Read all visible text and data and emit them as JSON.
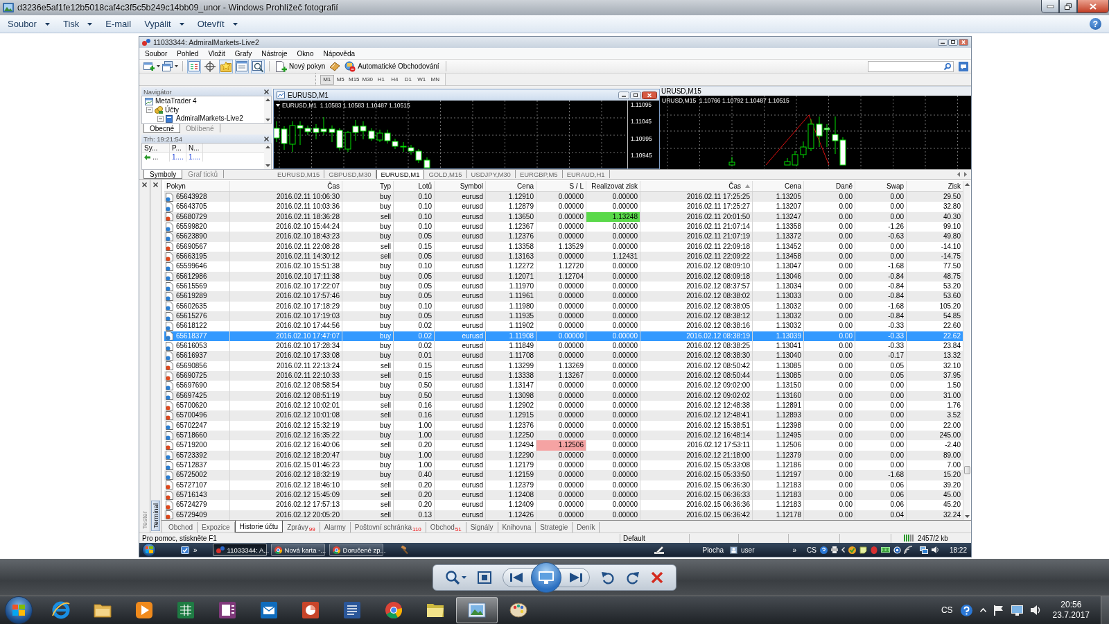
{
  "window": {
    "title": "d3236e5af1fe12b5018caf4c3f5c5b249c14bb09_unor - Windows Prohlížeč fotografií"
  },
  "menu": [
    {
      "label": "Soubor",
      "dropdown": true
    },
    {
      "label": "Tisk",
      "dropdown": true
    },
    {
      "label": "E-mail",
      "dropdown": false
    },
    {
      "label": "Vypálit",
      "dropdown": true
    },
    {
      "label": "Otevřít",
      "dropdown": true
    }
  ],
  "help": "?",
  "mt4": {
    "title": "11033344: AdmiralMarkets-Live2",
    "menu": [
      "Soubor",
      "Pohled",
      "Vložit",
      "Grafy",
      "Nástroje",
      "Okno",
      "Nápověda"
    ],
    "toolbar": {
      "toggles": [
        {
          "kind": "market-watch",
          "on": true
        },
        {
          "kind": "crosshair",
          "on": false
        },
        {
          "kind": "navigator",
          "on": true
        },
        {
          "kind": "terminal",
          "on": true
        },
        {
          "kind": "tester",
          "on": true
        }
      ],
      "new_order": "Nový pokyn",
      "auto_trading": "Automatické Obchodování"
    },
    "timeframes": [
      {
        "label": "M1",
        "selected": true
      },
      {
        "label": "M5",
        "selected": false
      },
      {
        "label": "M15",
        "selected": false
      },
      {
        "label": "M30",
        "selected": false
      },
      {
        "label": "H1",
        "selected": false
      },
      {
        "label": "H4",
        "selected": false
      },
      {
        "label": "D1",
        "selected": false
      },
      {
        "label": "W1",
        "selected": false
      },
      {
        "label": "MN",
        "selected": false
      }
    ],
    "navigator": {
      "title": "Navigátor",
      "tree": [
        {
          "label": "MetaTrader 4",
          "children": [
            {
              "label": "Účty",
              "expanded": true,
              "children": [
                {
                  "label": "AdmiralMarkets-Live2",
                  "expanded": true
                }
              ]
            }
          ]
        }
      ],
      "tabs": [
        {
          "label": "Obecné",
          "selected": true
        },
        {
          "label": "Oblíbené",
          "selected": false
        }
      ]
    },
    "market_watch": {
      "title": "Trh: 19:21:54",
      "columns": [
        "Sy...",
        "P...",
        "N..."
      ],
      "rows": [
        [
          "...",
          "1....",
          "1...."
        ]
      ],
      "tabs": [
        {
          "label": "Symboly",
          "selected": true
        },
        {
          "label": "Graf ticků",
          "selected": false
        }
      ]
    },
    "charts": [
      {
        "title": "EURUSD,M1",
        "active": true,
        "header": "EURUSD,M1  1.10583 1.10583 1.10487 1.10515",
        "price_labels": [
          "1.11095",
          "1.11045",
          "1.10995",
          "1.10945"
        ]
      },
      {
        "title": "URUSD,M15",
        "active": false,
        "header": "URUSD,M15  1.10766 1.10792 1.10487 1.10515"
      }
    ],
    "chart_tabs": [
      {
        "label": "EURUSD,M15",
        "selected": false
      },
      {
        "label": "GBPUSD,M30",
        "selected": false
      },
      {
        "label": "EURUSD,M1",
        "selected": true
      },
      {
        "label": "GOLD,M15",
        "selected": false
      },
      {
        "label": "USDJPY,M30",
        "selected": false
      },
      {
        "label": "EURGBP,M5",
        "selected": false
      },
      {
        "label": "EURAUD,H1",
        "selected": false
      }
    ],
    "terminal": {
      "side_tabs": [
        {
          "label": "Tester",
          "selected": false
        },
        {
          "label": "Terminal",
          "selected": true
        }
      ],
      "columns": [
        {
          "label": "Pokyn",
          "sorted": false
        },
        {
          "label": "Čas",
          "sorted": false
        },
        {
          "label": "Typ",
          "sorted": false
        },
        {
          "label": "Lotů",
          "sorted": false
        },
        {
          "label": "Symbol",
          "sorted": false
        },
        {
          "label": "Cena",
          "sorted": false
        },
        {
          "label": "S / L",
          "sorted": false
        },
        {
          "label": "Realizovat zisk",
          "sorted": false
        },
        {
          "label": "Čas",
          "sorted": true
        },
        {
          "label": "Cena",
          "sorted": false
        },
        {
          "label": "Daně",
          "sorted": false
        },
        {
          "label": "Swap",
          "sorted": false
        },
        {
          "label": "Zisk",
          "sorted": false
        }
      ],
      "rows": [
        {
          "kind": "buy",
          "selected": false,
          "sl_hit": false,
          "tp_hit": false,
          "cells": [
            "65643928",
            "2016.02.11 10:06:30",
            "buy",
            "0.10",
            "eurusd",
            "1.12910",
            "0.00000",
            "0.00000",
            "2016.02.11 17:25:25",
            "1.13205",
            "0.00",
            "0.00",
            "29.50"
          ]
        },
        {
          "kind": "buy",
          "selected": false,
          "sl_hit": false,
          "tp_hit": false,
          "cells": [
            "65643705",
            "2016.02.11 10:03:36",
            "buy",
            "0.10",
            "eurusd",
            "1.12879",
            "0.00000",
            "0.00000",
            "2016.02.11 17:25:27",
            "1.13207",
            "0.00",
            "0.00",
            "32.80"
          ]
        },
        {
          "kind": "sell",
          "selected": false,
          "sl_hit": false,
          "tp_hit": true,
          "cells": [
            "65680729",
            "2016.02.11 18:36:28",
            "sell",
            "0.10",
            "eurusd",
            "1.13650",
            "0.00000",
            "1.13248",
            "2016.02.11 20:01:50",
            "1.13247",
            "0.00",
            "0.00",
            "40.30"
          ]
        },
        {
          "kind": "buy",
          "selected": false,
          "sl_hit": false,
          "tp_hit": false,
          "cells": [
            "65599820",
            "2016.02.10 15:44:24",
            "buy",
            "0.10",
            "eurusd",
            "1.12367",
            "0.00000",
            "0.00000",
            "2016.02.11 21:07:14",
            "1.13358",
            "0.00",
            "-1.26",
            "99.10"
          ]
        },
        {
          "kind": "buy",
          "selected": false,
          "sl_hit": false,
          "tp_hit": false,
          "cells": [
            "65623890",
            "2016.02.10 18:43:23",
            "buy",
            "0.05",
            "eurusd",
            "1.12376",
            "0.00000",
            "0.00000",
            "2016.02.11 21:07:19",
            "1.13372",
            "0.00",
            "-0.63",
            "49.80"
          ]
        },
        {
          "kind": "sell",
          "selected": false,
          "sl_hit": false,
          "tp_hit": false,
          "cells": [
            "65690567",
            "2016.02.11 22:08:28",
            "sell",
            "0.15",
            "eurusd",
            "1.13358",
            "1.13529",
            "0.00000",
            "2016.02.11 22:09:18",
            "1.13452",
            "0.00",
            "0.00",
            "-14.10"
          ]
        },
        {
          "kind": "sell",
          "selected": false,
          "sl_hit": false,
          "tp_hit": false,
          "cells": [
            "65663195",
            "2016.02.11 14:30:12",
            "sell",
            "0.05",
            "eurusd",
            "1.13163",
            "0.00000",
            "1.12431",
            "2016.02.11 22:09:22",
            "1.13458",
            "0.00",
            "0.00",
            "-14.75"
          ]
        },
        {
          "kind": "buy",
          "selected": false,
          "sl_hit": false,
          "tp_hit": false,
          "cells": [
            "65599646",
            "2016.02.10 15:51:38",
            "buy",
            "0.10",
            "eurusd",
            "1.12272",
            "1.12720",
            "0.00000",
            "2016.02.12 08:09:10",
            "1.13047",
            "0.00",
            "-1.68",
            "77.50"
          ]
        },
        {
          "kind": "buy",
          "selected": false,
          "sl_hit": false,
          "tp_hit": false,
          "cells": [
            "65612986",
            "2016.02.10 17:11:38",
            "buy",
            "0.05",
            "eurusd",
            "1.12071",
            "1.12704",
            "0.00000",
            "2016.02.12 08:09:18",
            "1.13046",
            "0.00",
            "-0.84",
            "48.75"
          ]
        },
        {
          "kind": "buy",
          "selected": false,
          "sl_hit": false,
          "tp_hit": false,
          "cells": [
            "65615569",
            "2016.02.10 17:22:07",
            "buy",
            "0.05",
            "eurusd",
            "1.11970",
            "0.00000",
            "0.00000",
            "2016.02.12 08:37:57",
            "1.13034",
            "0.00",
            "-0.84",
            "53.20"
          ]
        },
        {
          "kind": "buy",
          "selected": false,
          "sl_hit": false,
          "tp_hit": false,
          "cells": [
            "65619289",
            "2016.02.10 17:57:46",
            "buy",
            "0.05",
            "eurusd",
            "1.11961",
            "0.00000",
            "0.00000",
            "2016.02.12 08:38:02",
            "1.13033",
            "0.00",
            "-0.84",
            "53.60"
          ]
        },
        {
          "kind": "buy",
          "selected": false,
          "sl_hit": false,
          "tp_hit": false,
          "cells": [
            "65602635",
            "2016.02.10 17:18:29",
            "buy",
            "0.10",
            "eurusd",
            "1.11980",
            "0.00000",
            "0.00000",
            "2016.02.12 08:38:05",
            "1.13032",
            "0.00",
            "-1.68",
            "105.20"
          ]
        },
        {
          "kind": "buy",
          "selected": false,
          "sl_hit": false,
          "tp_hit": false,
          "cells": [
            "65615276",
            "2016.02.10 17:19:03",
            "buy",
            "0.05",
            "eurusd",
            "1.11935",
            "0.00000",
            "0.00000",
            "2016.02.12 08:38:12",
            "1.13032",
            "0.00",
            "-0.84",
            "54.85"
          ]
        },
        {
          "kind": "buy",
          "selected": false,
          "sl_hit": false,
          "tp_hit": false,
          "cells": [
            "65618122",
            "2016.02.10 17:44:56",
            "buy",
            "0.02",
            "eurusd",
            "1.11902",
            "0.00000",
            "0.00000",
            "2016.02.12 08:38:16",
            "1.13032",
            "0.00",
            "-0.33",
            "22.60"
          ]
        },
        {
          "kind": "buy",
          "selected": true,
          "sl_hit": false,
          "tp_hit": false,
          "cells": [
            "65618377",
            "2016.02.10 17:47:07",
            "buy",
            "0.02",
            "eurusd",
            "1.11908",
            "0.00000",
            "0.00000",
            "2016.02.12 08:38:19",
            "1.13039",
            "0.00",
            "-0.33",
            "22.62"
          ]
        },
        {
          "kind": "buy",
          "selected": false,
          "sl_hit": false,
          "tp_hit": false,
          "cells": [
            "65616053",
            "2016.02.10 17:28:34",
            "buy",
            "0.02",
            "eurusd",
            "1.11849",
            "0.00000",
            "0.00000",
            "2016.02.12 08:38:25",
            "1.13041",
            "0.00",
            "-0.33",
            "23.84"
          ]
        },
        {
          "kind": "buy",
          "selected": false,
          "sl_hit": false,
          "tp_hit": false,
          "cells": [
            "65616937",
            "2016.02.10 17:33:08",
            "buy",
            "0.01",
            "eurusd",
            "1.11708",
            "0.00000",
            "0.00000",
            "2016.02.12 08:38:30",
            "1.13040",
            "0.00",
            "-0.17",
            "13.32"
          ]
        },
        {
          "kind": "sell",
          "selected": false,
          "sl_hit": false,
          "tp_hit": false,
          "cells": [
            "65690856",
            "2016.02.11 22:13:24",
            "sell",
            "0.15",
            "eurusd",
            "1.13299",
            "1.13269",
            "0.00000",
            "2016.02.12 08:50:42",
            "1.13085",
            "0.00",
            "0.05",
            "32.10"
          ]
        },
        {
          "kind": "sell",
          "selected": false,
          "sl_hit": false,
          "tp_hit": false,
          "cells": [
            "65690725",
            "2016.02.11 22:10:33",
            "sell",
            "0.15",
            "eurusd",
            "1.13338",
            "1.13267",
            "0.00000",
            "2016.02.12 08:50:44",
            "1.13085",
            "0.00",
            "0.05",
            "37.95"
          ]
        },
        {
          "kind": "buy",
          "selected": false,
          "sl_hit": false,
          "tp_hit": false,
          "cells": [
            "65697690",
            "2016.02.12 08:58:54",
            "buy",
            "0.50",
            "eurusd",
            "1.13147",
            "0.00000",
            "0.00000",
            "2016.02.12 09:02:00",
            "1.13150",
            "0.00",
            "0.00",
            "1.50"
          ]
        },
        {
          "kind": "buy",
          "selected": false,
          "sl_hit": false,
          "tp_hit": false,
          "cells": [
            "65697425",
            "2016.02.12 08:51:19",
            "buy",
            "0.50",
            "eurusd",
            "1.13098",
            "0.00000",
            "0.00000",
            "2016.02.12 09:02:02",
            "1.13160",
            "0.00",
            "0.00",
            "31.00"
          ]
        },
        {
          "kind": "sell",
          "selected": false,
          "sl_hit": false,
          "tp_hit": false,
          "cells": [
            "65700620",
            "2016.02.12 10:02:01",
            "sell",
            "0.16",
            "eurusd",
            "1.12902",
            "0.00000",
            "0.00000",
            "2016.02.12 12:48:38",
            "1.12891",
            "0.00",
            "0.00",
            "1.76"
          ]
        },
        {
          "kind": "sell",
          "selected": false,
          "sl_hit": false,
          "tp_hit": false,
          "cells": [
            "65700496",
            "2016.02.12 10:01:08",
            "sell",
            "0.16",
            "eurusd",
            "1.12915",
            "0.00000",
            "0.00000",
            "2016.02.12 12:48:41",
            "1.12893",
            "0.00",
            "0.00",
            "3.52"
          ]
        },
        {
          "kind": "buy",
          "selected": false,
          "sl_hit": false,
          "tp_hit": false,
          "cells": [
            "65702247",
            "2016.02.12 15:32:19",
            "buy",
            "1.00",
            "eurusd",
            "1.12376",
            "0.00000",
            "0.00000",
            "2016.02.12 15:38:51",
            "1.12398",
            "0.00",
            "0.00",
            "22.00"
          ]
        },
        {
          "kind": "buy",
          "selected": false,
          "sl_hit": false,
          "tp_hit": false,
          "cells": [
            "65718660",
            "2016.02.12 16:35:22",
            "buy",
            "1.00",
            "eurusd",
            "1.12250",
            "0.00000",
            "0.00000",
            "2016.02.12 16:48:14",
            "1.12495",
            "0.00",
            "0.00",
            "245.00"
          ]
        },
        {
          "kind": "sell",
          "selected": false,
          "sl_hit": true,
          "tp_hit": false,
          "cells": [
            "65719200",
            "2016.02.12 16:40:06",
            "sell",
            "0.20",
            "eurusd",
            "1.12494",
            "1.12506",
            "0.00000",
            "2016.02.12 17:53:11",
            "1.12506",
            "0.00",
            "0.00",
            "-2.40"
          ]
        },
        {
          "kind": "buy",
          "selected": false,
          "sl_hit": false,
          "tp_hit": false,
          "cells": [
            "65723392",
            "2016.02.12 18:20:47",
            "buy",
            "1.00",
            "eurusd",
            "1.12290",
            "0.00000",
            "0.00000",
            "2016.02.12 21:18:00",
            "1.12379",
            "0.00",
            "0.00",
            "89.00"
          ]
        },
        {
          "kind": "buy",
          "selected": false,
          "sl_hit": false,
          "tp_hit": false,
          "cells": [
            "65712837",
            "2016.02.15 01:46:23",
            "buy",
            "1.00",
            "eurusd",
            "1.12179",
            "0.00000",
            "0.00000",
            "2016.02.15 05:33:08",
            "1.12186",
            "0.00",
            "0.00",
            "7.00"
          ]
        },
        {
          "kind": "buy",
          "selected": false,
          "sl_hit": false,
          "tp_hit": false,
          "cells": [
            "65725002",
            "2016.02.12 18:32:19",
            "buy",
            "0.40",
            "eurusd",
            "1.12159",
            "0.00000",
            "0.00000",
            "2016.02.15 05:33:50",
            "1.12197",
            "0.00",
            "-1.68",
            "15.20"
          ]
        },
        {
          "kind": "sell",
          "selected": false,
          "sl_hit": false,
          "tp_hit": false,
          "cells": [
            "65727107",
            "2016.02.12 18:46:10",
            "sell",
            "0.20",
            "eurusd",
            "1.12379",
            "0.00000",
            "0.00000",
            "2016.02.15 06:36:30",
            "1.12183",
            "0.00",
            "0.06",
            "39.20"
          ]
        },
        {
          "kind": "sell",
          "selected": false,
          "sl_hit": false,
          "tp_hit": false,
          "cells": [
            "65716143",
            "2016.02.12 15:45:09",
            "sell",
            "0.20",
            "eurusd",
            "1.12408",
            "0.00000",
            "0.00000",
            "2016.02.15 06:36:33",
            "1.12183",
            "0.00",
            "0.06",
            "45.00"
          ]
        },
        {
          "kind": "sell",
          "selected": false,
          "sl_hit": false,
          "tp_hit": false,
          "cells": [
            "65724279",
            "2016.02.12 17:57:13",
            "sell",
            "0.20",
            "eurusd",
            "1.12409",
            "0.00000",
            "0.00000",
            "2016.02.15 06:36:36",
            "1.12183",
            "0.00",
            "0.06",
            "45.20"
          ]
        },
        {
          "kind": "sell",
          "selected": false,
          "sl_hit": false,
          "tp_hit": false,
          "cells": [
            "65729409",
            "2016.02.12 20:05:20",
            "sell",
            "0.13",
            "eurusd",
            "1.12426",
            "0.00000",
            "0.00000",
            "2016.02.15 06:36:42",
            "1.12178",
            "0.00",
            "0.04",
            "32.24"
          ]
        }
      ],
      "tabs": [
        {
          "label": "Obchod",
          "selected": false
        },
        {
          "label": "Expozice",
          "selected": false
        },
        {
          "label": "Historie účtu",
          "selected": true
        },
        {
          "label": "Zprávy",
          "badge": "99",
          "selected": false
        },
        {
          "label": "Alarmy",
          "selected": false
        },
        {
          "label": "Poštovní schránka",
          "badge": "110",
          "selected": false
        },
        {
          "label": "Obchod",
          "badge": "51",
          "selected": false
        },
        {
          "label": "Signály",
          "selected": false
        },
        {
          "label": "Knihovna",
          "selected": false
        },
        {
          "label": "Strategie",
          "selected": false
        },
        {
          "label": "Deník",
          "selected": false
        }
      ]
    },
    "status_bar": [
      "Pro pomoc, stiskněte F1",
      "Default",
      "2457/2 kb"
    ],
    "taskbar": {
      "more_left": "»",
      "buttons": [
        {
          "kind": "app",
          "label": "11033344: A...",
          "active": true
        },
        {
          "kind": "browser",
          "label": "Nová karta -...",
          "active": false
        },
        {
          "kind": "browser",
          "label": "Doručené zp...",
          "active": false
        }
      ],
      "desktop": "Plocha",
      "user": "user",
      "more_right": "»",
      "language": "CS",
      "time": "18:22"
    }
  },
  "taskbar": {
    "apps": [
      {
        "kind": "ie",
        "active": false
      },
      {
        "kind": "explorer",
        "active": false
      },
      {
        "kind": "media",
        "active": false
      },
      {
        "kind": "spreadsheet",
        "active": false
      },
      {
        "kind": "notes",
        "active": false
      },
      {
        "kind": "mail",
        "active": false
      },
      {
        "kind": "slides",
        "active": false
      },
      {
        "kind": "document",
        "active": false
      },
      {
        "kind": "chrome",
        "active": false
      },
      {
        "kind": "folder",
        "active": false
      },
      {
        "kind": "photos",
        "active": true
      },
      {
        "kind": "paint",
        "active": false
      }
    ],
    "language": "CS",
    "time": "20:56",
    "date": "23.7.2017"
  }
}
